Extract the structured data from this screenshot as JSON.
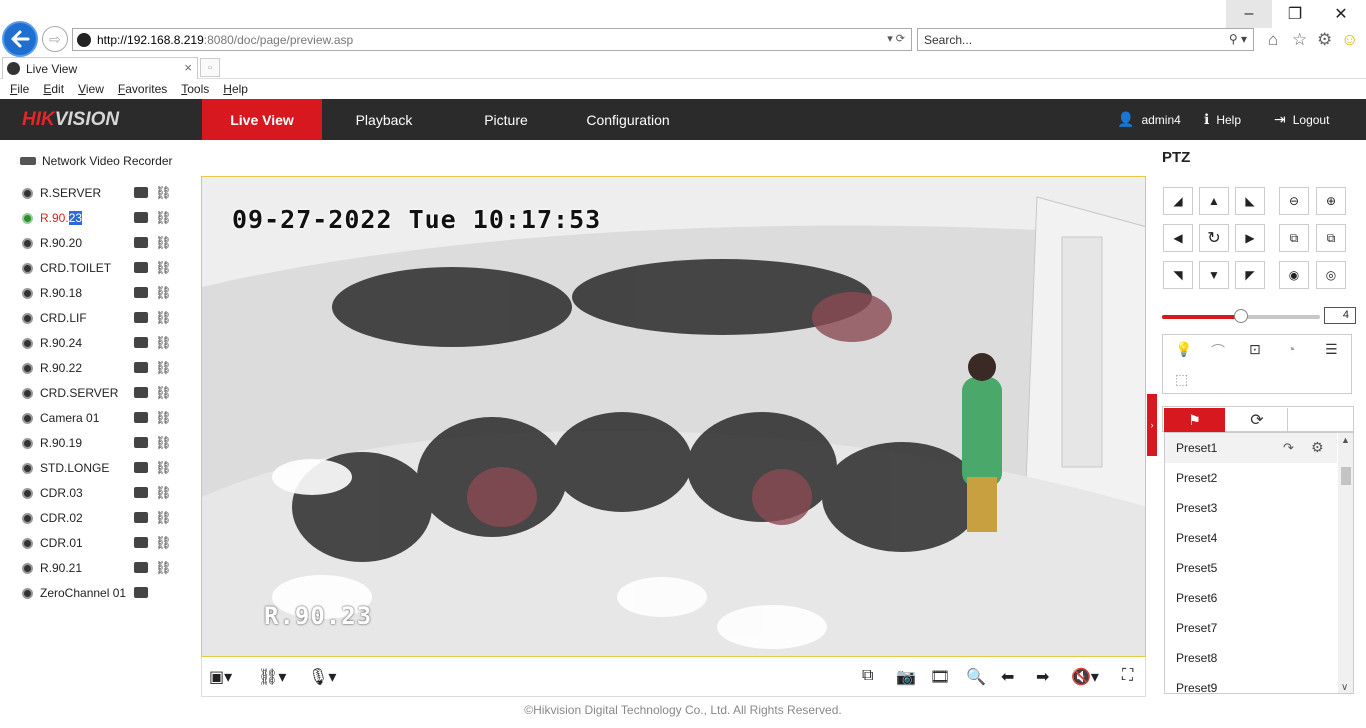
{
  "browser": {
    "url_host": "http://192.168.8.219",
    "url_rest": ":8080/doc/page/preview.asp",
    "search_placeholder": "Search...",
    "tab_title": "Live View",
    "menu": [
      "File",
      "Edit",
      "View",
      "Favorites",
      "Tools",
      "Help"
    ]
  },
  "app": {
    "logo_red": "HIK",
    "logo_gray": "VISION",
    "nav": {
      "live": "Live View",
      "playback": "Playback",
      "picture": "Picture",
      "configuration": "Configuration"
    },
    "user": "admin4",
    "help": "Help",
    "logout": "Logout"
  },
  "tree": {
    "root": "Network Video Recorder",
    "cameras": [
      {
        "name": "R.SERVER",
        "ptz": true
      },
      {
        "name_prefix": "R.90.",
        "name_sel": "23",
        "ptz": true,
        "active": true
      },
      {
        "name": "R.90.20",
        "ptz": true
      },
      {
        "name": "CRD.TOILET",
        "ptz": true
      },
      {
        "name": "R.90.18",
        "ptz": true
      },
      {
        "name": "CRD.LIF",
        "ptz": true
      },
      {
        "name": "R.90.24",
        "ptz": true
      },
      {
        "name": "R.90.22",
        "ptz": true
      },
      {
        "name": "CRD.SERVER",
        "ptz": true
      },
      {
        "name": "Camera 01",
        "ptz": true
      },
      {
        "name": "R.90.19",
        "ptz": true
      },
      {
        "name": "STD.LONGE",
        "ptz": true
      },
      {
        "name": "CDR.03",
        "ptz": true
      },
      {
        "name": "CDR.02",
        "ptz": true
      },
      {
        "name": "CDR.01",
        "ptz": true
      },
      {
        "name": "R.90.21",
        "ptz": true
      },
      {
        "name": "ZeroChannel 01",
        "ptz": false
      }
    ]
  },
  "video": {
    "osd_datetime": "09-27-2022 Tue 10:17:53",
    "osd_channel": "R.90.23"
  },
  "ptz": {
    "title": "PTZ",
    "speed": 4,
    "speed_fraction": 0.5,
    "presets": [
      "Preset1",
      "Preset2",
      "Preset3",
      "Preset4",
      "Preset5",
      "Preset6",
      "Preset7",
      "Preset8",
      "Preset9"
    ]
  },
  "footer": "©Hikvision Digital Technology Co., Ltd. All Rights Reserved.",
  "colors": {
    "accent": "#d7191f",
    "header_bg": "#2b2b2b"
  }
}
